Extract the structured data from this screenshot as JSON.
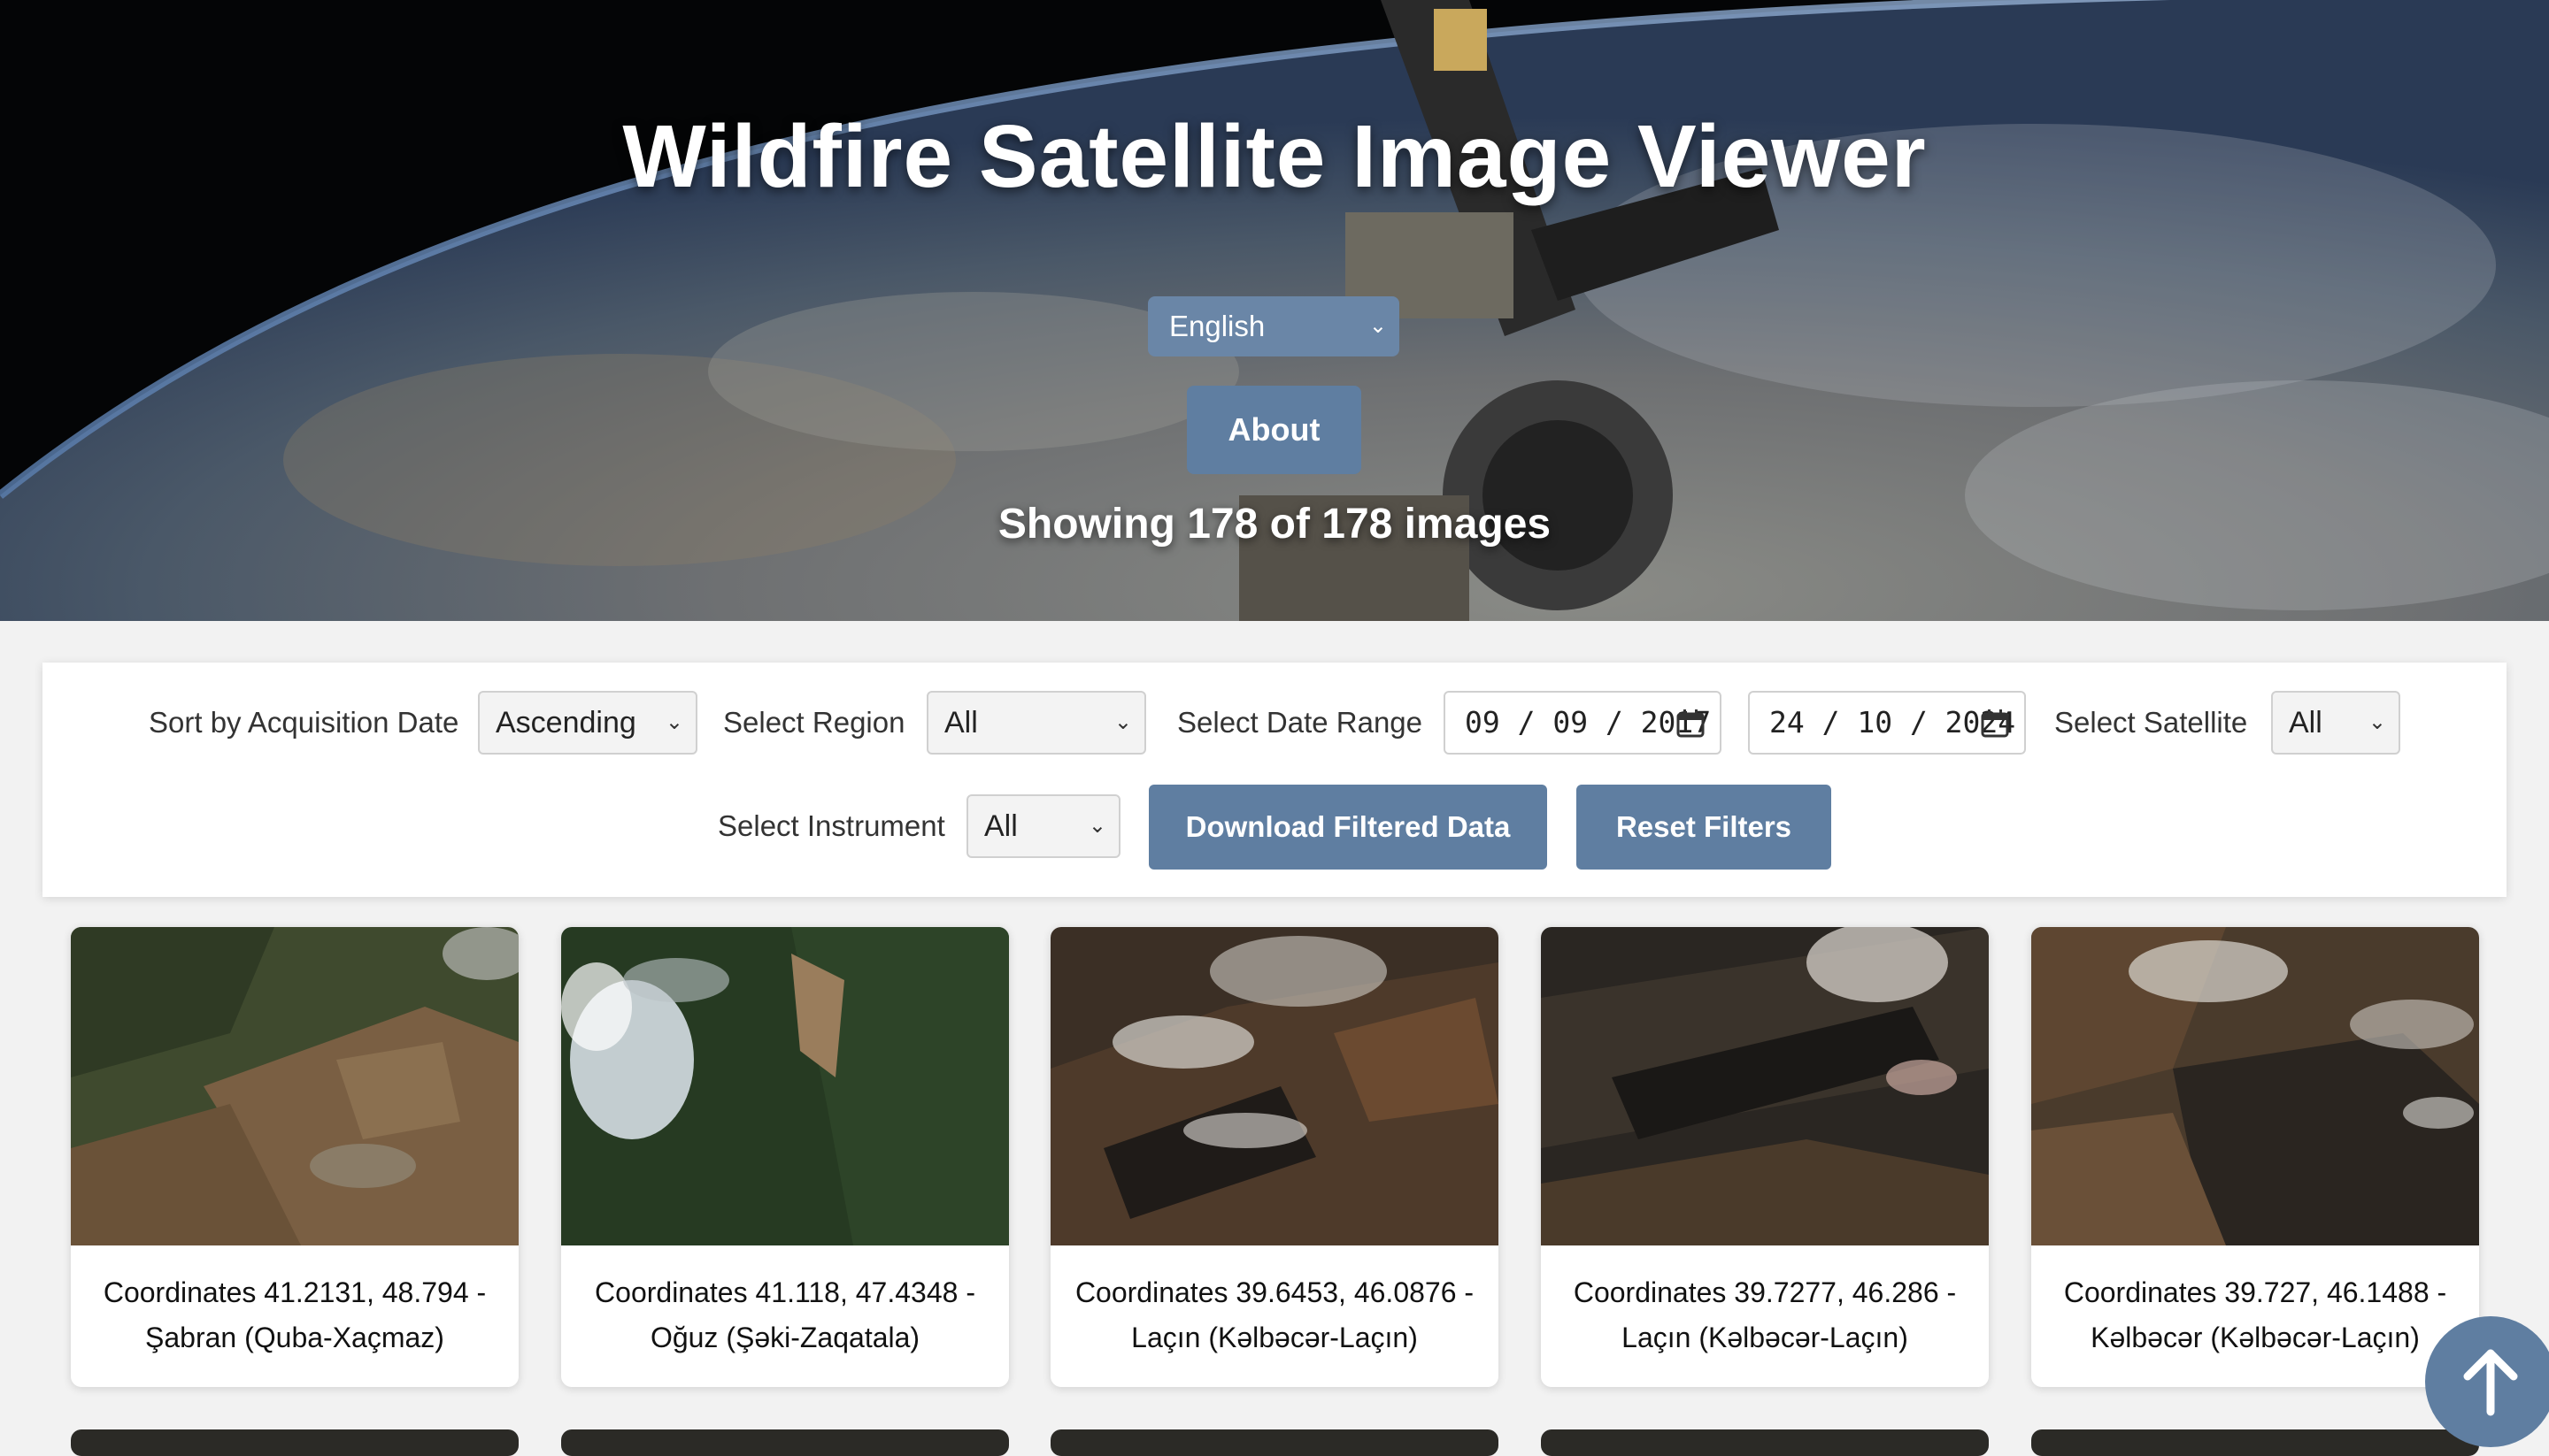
{
  "header": {
    "title": "Wildfire Satellite Image Viewer",
    "language_selected": "English",
    "about_label": "About",
    "count_text": "Showing 178 of 178 images"
  },
  "filters": {
    "sort_label": "Sort by Acquisition Date",
    "sort_value": "Ascending",
    "region_label": "Select Region",
    "region_value": "All",
    "date_range_label": "Select Date Range",
    "date_start": "09 / 09 / 2017",
    "date_end": "24 / 10 / 2024",
    "satellite_label": "Select Satellite",
    "satellite_value": "All",
    "instrument_label": "Select Instrument",
    "instrument_value": "All",
    "download_label": "Download Filtered Data",
    "reset_label": "Reset Filters"
  },
  "cards": [
    {
      "line1": "Coordinates 41.2131, 48.794 -",
      "line2": "Şabran (Quba-Xaçmaz)"
    },
    {
      "line1": "Coordinates 41.118, 47.4348 -",
      "line2": "Oğuz (Şəki-Zaqatala)"
    },
    {
      "line1": "Coordinates 39.6453, 46.0876 -",
      "line2": "Laçın (Kəlbəcər-Laçın)"
    },
    {
      "line1": "Coordinates 39.7277, 46.286 -",
      "line2": "Laçın (Kəlbəcər-Laçın)"
    },
    {
      "line1": "Coordinates 39.727, 46.1488 -",
      "line2": "Kəlbəcər (Kəlbəcər-Laçın)"
    }
  ],
  "colors": {
    "accent": "#5f7ea1",
    "language_select": "#6a86a7",
    "page_background": "#f2f2f2"
  },
  "icons": {
    "dropdown": "chevron-down-icon",
    "date": "calendar-icon",
    "scroll_top": "arrow-up-icon"
  }
}
